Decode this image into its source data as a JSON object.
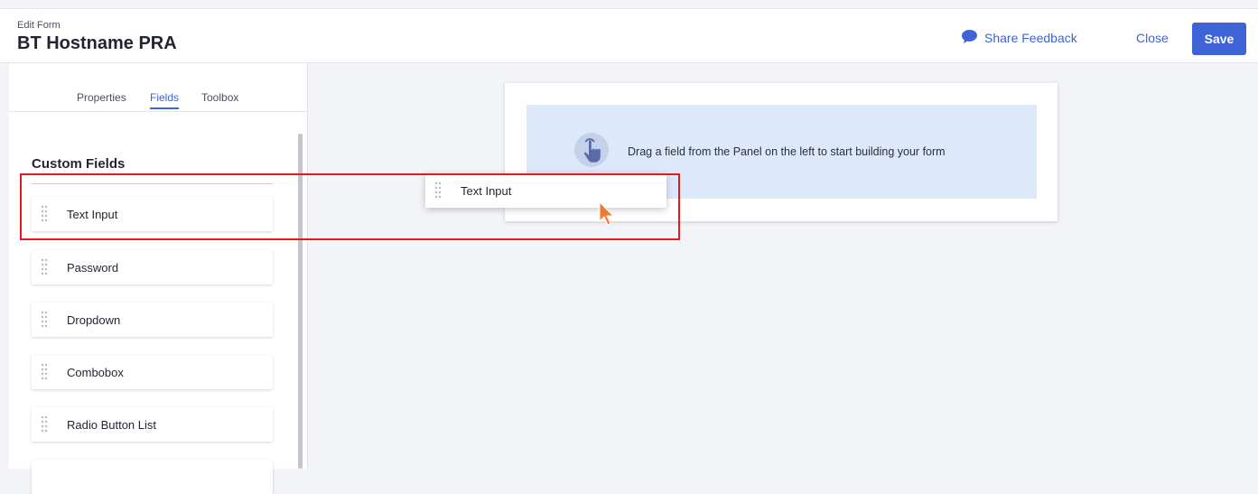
{
  "header": {
    "subtitle": "Edit Form",
    "title": "BT Hostname PRA",
    "share_feedback": "Share Feedback",
    "close": "Close",
    "save": "Save"
  },
  "tabs": [
    {
      "label": "Properties",
      "active": false
    },
    {
      "label": "Fields",
      "active": true
    },
    {
      "label": "Toolbox",
      "active": false
    }
  ],
  "custom_fields": {
    "title": "Custom Fields",
    "items": [
      "Text Input",
      "Password",
      "Dropdown",
      "Combobox",
      "Radio Button List"
    ]
  },
  "canvas": {
    "hint": "Drag a field from the Panel on the left to start building your form",
    "dragging_label": "Text Input"
  },
  "colors": {
    "accent": "#3d63d6",
    "dropzone": "#dde9fb",
    "highlight": "#e01b1b",
    "cursor": "#f07a2a"
  },
  "icons": {
    "share": "chat-bubble-icon",
    "grip": "drag-handle-icon",
    "dropzone": "hand-pointer-icon",
    "cursor": "mouse-cursor-icon"
  }
}
